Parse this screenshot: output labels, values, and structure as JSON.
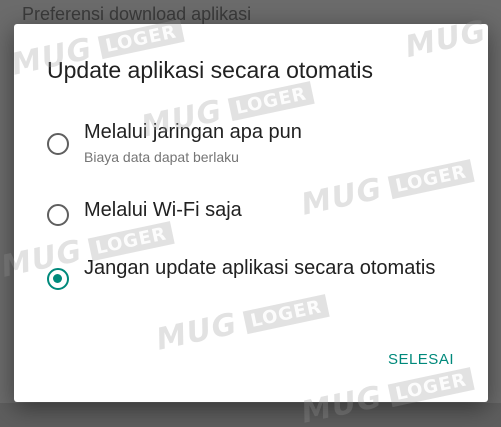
{
  "background": {
    "header_text": "Preferensi download aplikasi"
  },
  "dialog": {
    "title": "Update aplikasi secara otomatis",
    "options": [
      {
        "label": "Melalui jaringan apa pun",
        "sublabel": "Biaya data dapat berlaku",
        "checked": false
      },
      {
        "label": "Melalui Wi-Fi saja",
        "checked": false
      },
      {
        "label": "Jangan update aplikasi secara otomatis",
        "checked": true
      }
    ],
    "action_label": "SELESAI"
  },
  "watermark": {
    "brand": "MUG",
    "brand_box": "LOGER"
  },
  "colors": {
    "accent": "#00897b",
    "scrim": "#6b6b6b"
  }
}
